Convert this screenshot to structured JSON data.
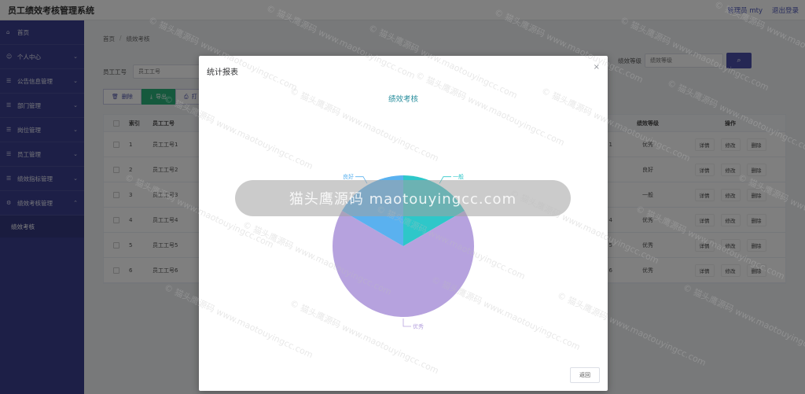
{
  "app": {
    "title": "员工绩效考核管理系统",
    "admin": "管理员 mty",
    "logout": "退出登录"
  },
  "sidebar": {
    "items": [
      {
        "label": "首页",
        "icon": "home-icon"
      },
      {
        "label": "个人中心",
        "icon": "user-icon"
      },
      {
        "label": "公告信息管理",
        "icon": "menu-icon"
      },
      {
        "label": "部门管理",
        "icon": "menu-icon"
      },
      {
        "label": "岗位管理",
        "icon": "menu-icon"
      },
      {
        "label": "员工管理",
        "icon": "menu-icon"
      },
      {
        "label": "绩效指标管理",
        "icon": "menu-icon"
      },
      {
        "label": "绩效考核管理",
        "icon": "gear-icon"
      }
    ],
    "sub_item": "绩效考核"
  },
  "breadcrumb": {
    "home": "首页",
    "sep": "/",
    "current": "绩效考核"
  },
  "search": {
    "label": "员工工号",
    "placeholder": "员工工号",
    "grade_label": "绩效等级",
    "grade_placeholder": "绩效等级"
  },
  "toolbar": {
    "delete": "删除",
    "export": "导出",
    "print": "打"
  },
  "table": {
    "headers": {
      "index": "索引",
      "emp_no": "员工工号",
      "grade": "绩效等级",
      "op": "操作"
    },
    "rows": [
      {
        "index": "1",
        "emp_no": "员工工号1",
        "mid": "1",
        "grade": "优秀"
      },
      {
        "index": "2",
        "emp_no": "员工工号2",
        "mid": "",
        "grade": "良好"
      },
      {
        "index": "3",
        "emp_no": "员工工号3",
        "mid": "",
        "grade": "一般"
      },
      {
        "index": "4",
        "emp_no": "员工工号4",
        "mid": "4",
        "grade": "优秀"
      },
      {
        "index": "5",
        "emp_no": "员工工号5",
        "mid": "5",
        "grade": "优秀"
      },
      {
        "index": "6",
        "emp_no": "员工工号6",
        "mid": "6",
        "grade": "优秀"
      }
    ],
    "ops": {
      "detail": "详情",
      "edit": "修改",
      "delete": "删除"
    }
  },
  "modal": {
    "title": "统计报表",
    "close": "×",
    "return_label": "返回"
  },
  "chart_data": {
    "type": "pie",
    "title": "绩效考核",
    "slices": [
      {
        "label": "一般",
        "value": 1,
        "color": "#2ec7c9"
      },
      {
        "label": "优秀",
        "value": 4,
        "color": "#b6a2de"
      },
      {
        "label": "良好",
        "value": 1,
        "color": "#5ab1ef"
      }
    ]
  },
  "watermark": {
    "pill_text": "猫头鹰源码 maotouyingcc.com",
    "small_text": "© 猫头鹰源码 www.maotouyingcc.com"
  }
}
